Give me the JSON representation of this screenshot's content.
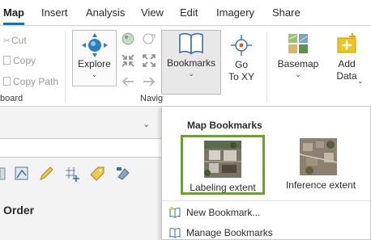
{
  "tabs": [
    {
      "label": "Map",
      "active": true
    },
    {
      "label": "Insert"
    },
    {
      "label": "Analysis"
    },
    {
      "label": "View"
    },
    {
      "label": "Edit"
    },
    {
      "label": "Imagery"
    },
    {
      "label": "Share"
    }
  ],
  "clipboard": {
    "cut": "Cut",
    "copy": "Copy",
    "copy_path": "Copy Path",
    "group_label": "board"
  },
  "navigate": {
    "explore": "Explore",
    "bookmarks": "Bookmarks",
    "go_to_xy_line1": "Go",
    "go_to_xy_line2": "To XY",
    "group_label": "Navig"
  },
  "layer": {
    "basemap": "Basemap",
    "add_data_line1": "Add",
    "add_data_line2": "Data"
  },
  "pane": {
    "heading": "Order"
  },
  "bookmarks_menu": {
    "title": "Map Bookmarks",
    "items": [
      {
        "label": "Labeling extent",
        "selected": true
      },
      {
        "label": "Inference extent",
        "selected": false
      }
    ],
    "new_bookmark": "New Bookmark...",
    "manage_bookmarks": "Manage Bookmarks"
  },
  "colors": {
    "accent": "#007ac2",
    "selection": "#6aa329"
  }
}
